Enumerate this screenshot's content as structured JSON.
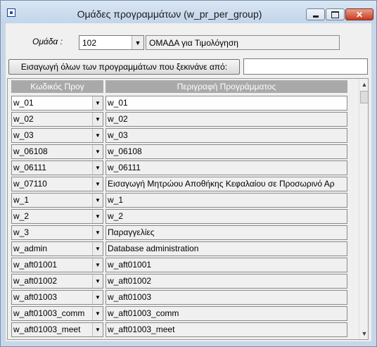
{
  "window": {
    "title": "Ομάδες προγραμμάτων   (w_pr_per_group)",
    "min_glyph": "",
    "max_glyph": "",
    "close_glyph": "✕"
  },
  "group": {
    "label": "Ομάδα :",
    "value": "102",
    "description": "ΟΜΑΔΑ για Τιμολόγηση"
  },
  "import": {
    "button_label": "Εισαγωγή όλων των προγραμμάτων που ξεκινάνε από:",
    "value": ""
  },
  "grid": {
    "columns": {
      "code": "Κωδικός Προγ",
      "description": "Περιγραφή Προγράμματος"
    },
    "rows": [
      {
        "code": "w_01",
        "description": "w_01"
      },
      {
        "code": "w_02",
        "description": "w_02"
      },
      {
        "code": "w_03",
        "description": "w_03"
      },
      {
        "code": "w_06108",
        "description": "w_06108"
      },
      {
        "code": "w_06111",
        "description": "w_06111"
      },
      {
        "code": "w_07110",
        "description": "Εισαγωγή Μητρώου Αποθήκης Κεφαλαίου σε Προσωρινό Αρ"
      },
      {
        "code": "w_1",
        "description": "w_1"
      },
      {
        "code": "w_2",
        "description": "w_2"
      },
      {
        "code": "w_3",
        "description": "Παραγγελίες"
      },
      {
        "code": "w_admin",
        "description": "Database administration"
      },
      {
        "code": "w_aft01001",
        "description": "w_aft01001"
      },
      {
        "code": "w_aft01002",
        "description": "w_aft01002"
      },
      {
        "code": "w_aft01003",
        "description": "w_aft01003"
      },
      {
        "code": "w_aft01003_comm",
        "description": "w_aft01003_comm"
      },
      {
        "code": "w_aft01003_meet",
        "description": "w_aft01003_meet"
      }
    ]
  },
  "glyphs": {
    "dropdown": "▼",
    "scroll_up": "▲",
    "scroll_down": "▼"
  },
  "colors": {
    "title_bar": "#c6d7ea",
    "close_button": "#c73b22",
    "grid_header": "#a9a9a9"
  }
}
